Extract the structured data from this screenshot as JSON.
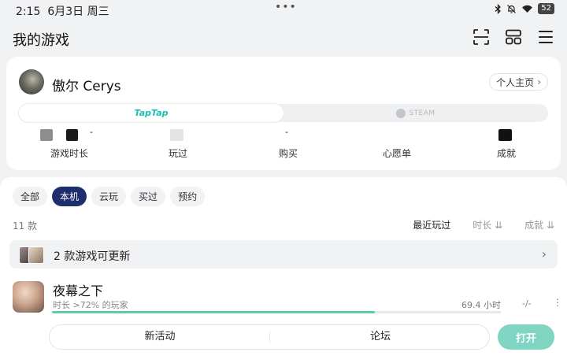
{
  "status_bar": {
    "time": "2:15",
    "date": "6月3日",
    "weekday": "周三",
    "dots": "•••",
    "battery": "52"
  },
  "header": {
    "title": "我的游戏"
  },
  "profile": {
    "username": "傲尔 Cerys",
    "homepage_label": "个人主页",
    "platforms": {
      "taptap": "TapTap",
      "steam": "STEAM"
    },
    "stats": [
      {
        "label": "游戏时长",
        "value": "-"
      },
      {
        "label": "玩过",
        "value": ""
      },
      {
        "label": "购买",
        "value": "-"
      },
      {
        "label": "心愿单",
        "value": ""
      },
      {
        "label": "成就",
        "value": ""
      }
    ]
  },
  "filters": {
    "tabs": [
      "全部",
      "本机",
      "云玩",
      "买过",
      "预约"
    ],
    "active_tab": "本机"
  },
  "list": {
    "count": "11 款",
    "sorts": [
      "最近玩过",
      "时长 ⇊",
      "成就 ⇊"
    ]
  },
  "update_banner": {
    "text": "2 款游戏可更新"
  },
  "game": {
    "name": "夜幕之下",
    "percentile": "时长 >72% 的玩家",
    "progress": 0.72,
    "hours": "69.4 小时",
    "achievements": "-/-",
    "more": "⋮",
    "actions": [
      "新活动",
      "论坛"
    ],
    "open_label": "打开"
  },
  "colors": {
    "accent_teal": "#19c0b4",
    "active_tab": "#1e2d6e",
    "progress": "#5fcca6",
    "open_button": "#7fd4c2"
  }
}
